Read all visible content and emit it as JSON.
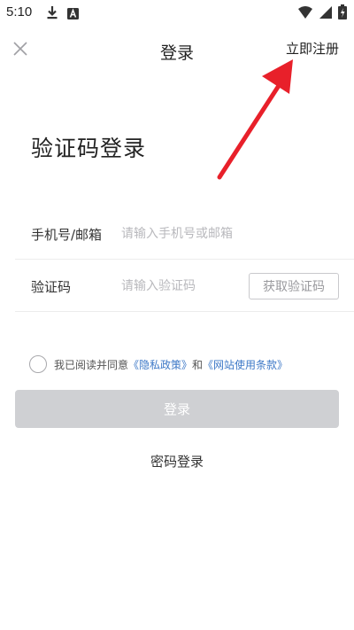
{
  "status_bar": {
    "time": "5:10",
    "left_icons": [
      "download-icon",
      "a-letter-icon"
    ],
    "right_icons": [
      "wifi-icon",
      "signal-icon",
      "battery-icon"
    ]
  },
  "nav": {
    "close_icon": "close-icon",
    "title": "登录",
    "register_label": "立即注册"
  },
  "heading": "验证码登录",
  "form": {
    "phone": {
      "label": "手机号/邮箱",
      "value": "",
      "placeholder": "请输入手机号或邮箱"
    },
    "code": {
      "label": "验证码",
      "value": "",
      "placeholder": "请输入验证码",
      "get_code_label": "获取验证码"
    }
  },
  "agreement": {
    "checked": false,
    "prefix": "我已阅读并同意",
    "privacy_link": "《隐私政策》",
    "conjunction": "和",
    "terms_link": "《网站使用条款》",
    "link_color": "#3e79c7"
  },
  "login_button": {
    "label": "登录",
    "disabled": true,
    "bg_color": "#cfd0d3"
  },
  "alt_login": {
    "password_login_label": "密码登录"
  },
  "annotation": {
    "type": "arrow",
    "color": "#e8202a",
    "points_to": "register-link"
  }
}
